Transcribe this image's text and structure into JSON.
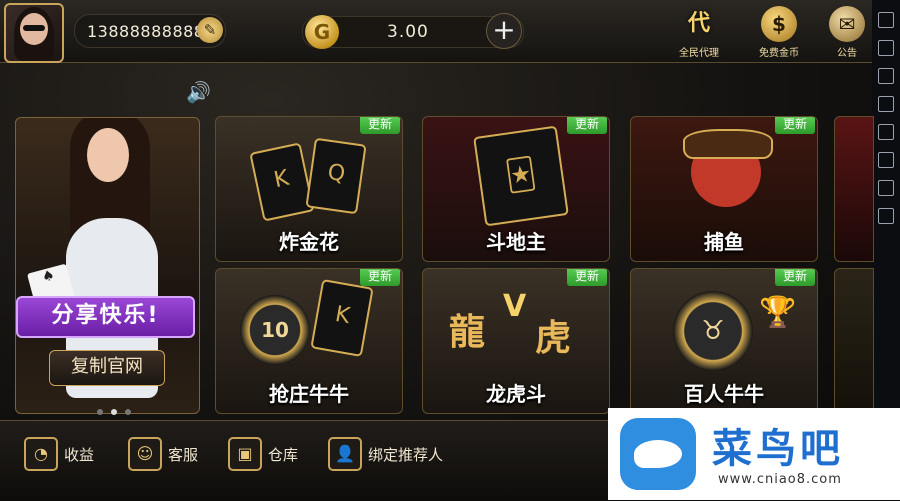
{
  "header": {
    "phone": "13888888888",
    "coin_symbol": "G",
    "balance": "3.00",
    "add_label": "+",
    "agent_label": "全民代理",
    "free_coins_label": "免费金币",
    "notice_label": "公告"
  },
  "banner": {
    "share_label": "分享快乐!",
    "copy_label": "复制官网",
    "page_count": 3,
    "active_page": 1
  },
  "games": [
    {
      "name": "炸金花",
      "badge": "更新"
    },
    {
      "name": "斗地主",
      "badge": "更新"
    },
    {
      "name": "捕鱼",
      "badge": "更新"
    },
    {
      "name": "抢庄牛牛",
      "badge": "更新"
    },
    {
      "name": "龙虎斗",
      "badge": "更新"
    },
    {
      "name": "百人牛牛",
      "badge": "更新"
    }
  ],
  "art": {
    "chip_value": "10",
    "dragon_char": "龍",
    "tiger_char": "虎",
    "card_k": "K",
    "card_q": "Q",
    "card_a": "A"
  },
  "bottom_nav": [
    {
      "label": "收益"
    },
    {
      "label": "客服"
    },
    {
      "label": "仓库"
    },
    {
      "label": "绑定推荐人"
    }
  ],
  "watermark": {
    "brand": "菜鸟吧",
    "url": "www.cniao8.com"
  },
  "colors": {
    "gold": "#c9a45a",
    "update_badge": "#3fb83a",
    "share_purple": "#7d2fbd",
    "watermark_blue": "#1f6fd0"
  }
}
